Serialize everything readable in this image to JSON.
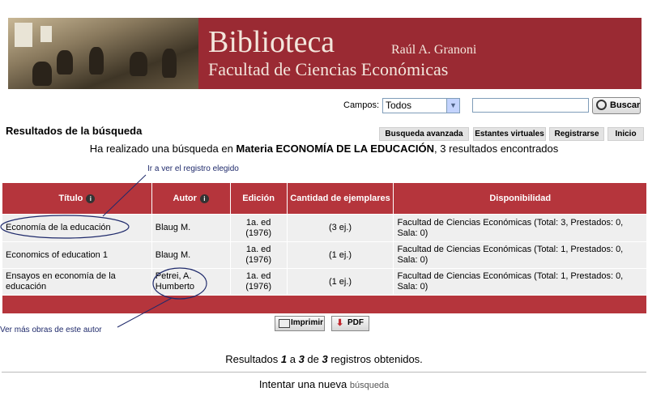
{
  "header": {
    "title": "Biblioteca",
    "subtitle": "Raúl A. Granoni",
    "faculty": "Facultad de Ciencias Económicas"
  },
  "search": {
    "campos_label": "Campos:",
    "campos_value": "Todos",
    "query_value": "",
    "button_label": "Buscar"
  },
  "page": {
    "results_title": "Resultados de la búsqueda",
    "summary_prefix": "Ha realizado una búsqueda en ",
    "summary_bold": "Materia ECONOMÍA DE LA EDUCACIÓN",
    "summary_suffix": ", 3 resultados encontrados"
  },
  "nav": {
    "advanced": "Busqueda avanzada",
    "shelves": "Estantes virtuales",
    "register": "Registrarse",
    "home": "Inicio"
  },
  "annotations": {
    "go_to_record": "Ir a ver el registro elegido",
    "more_by_author": "Ver más obras de este autor"
  },
  "table": {
    "headers": {
      "title": "Título",
      "author": "Autor",
      "edition": "Edición",
      "copies": "Cantidad de ejemplares",
      "availability": "Disponibilidad"
    },
    "rows": [
      {
        "title": "Economía de la educación",
        "author": "Blaug M.",
        "edition": "1a. ed (1976)",
        "copies": "(3  ej.)",
        "availability": "Facultad de Ciencias Económicas (Total: 3, Prestados: 0, Sala: 0)"
      },
      {
        "title": "Economics of education 1",
        "author": "Blaug M.",
        "edition": "1a. ed (1976)",
        "copies": "(1  ej.)",
        "availability": "Facultad de Ciencias Económicas (Total: 1, Prestados: 0, Sala: 0)"
      },
      {
        "title": "Ensayos en economía de la educación",
        "author": "Petrei, A. Humberto",
        "edition": "1a. ed (1976)",
        "copies": "(1  ej.)",
        "availability": "Facultad de Ciencias Económicas (Total: 1, Prestados: 0, Sala: 0)"
      }
    ]
  },
  "actions": {
    "print": "Imprimir",
    "pdf": "PDF"
  },
  "footer": {
    "results_prefix": "Resultados ",
    "results_from": "1",
    "results_mid": " a ",
    "results_to": "3",
    "results_of": " de ",
    "results_total": "3",
    "results_suffix": " registros obtenidos.",
    "new_search_prefix": "Intentar una nueva ",
    "new_search_link": "búsqueda"
  },
  "colors": {
    "brand_red": "#b5353c",
    "header_red": "#9a2a33",
    "annotation_blue": "#1f2a6b"
  }
}
